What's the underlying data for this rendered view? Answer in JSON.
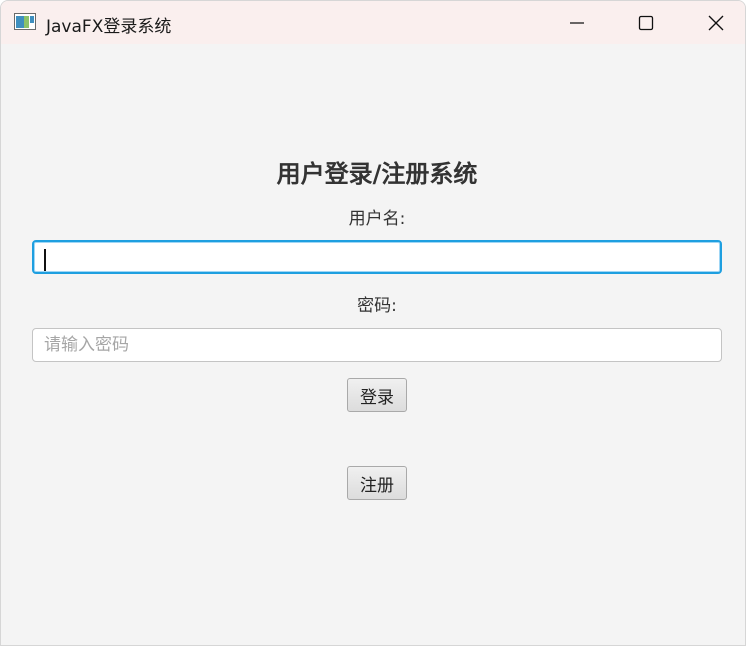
{
  "window": {
    "title": "JavaFX登录系统",
    "icon": "javafx-app-icon",
    "controls": {
      "minimize": "minimize-icon",
      "maximize": "maximize-icon",
      "close": "close-icon"
    }
  },
  "form": {
    "heading": "用户登录/注册系统",
    "username_label": "用户名:",
    "username_value": "",
    "password_label": "密码:",
    "password_placeholder": "请输入密码",
    "password_value": "",
    "login_button": "登录",
    "register_button": "注册"
  },
  "colors": {
    "titlebar": "#faefee",
    "background": "#f4f4f4",
    "focus_ring": "#1e9fe0"
  }
}
